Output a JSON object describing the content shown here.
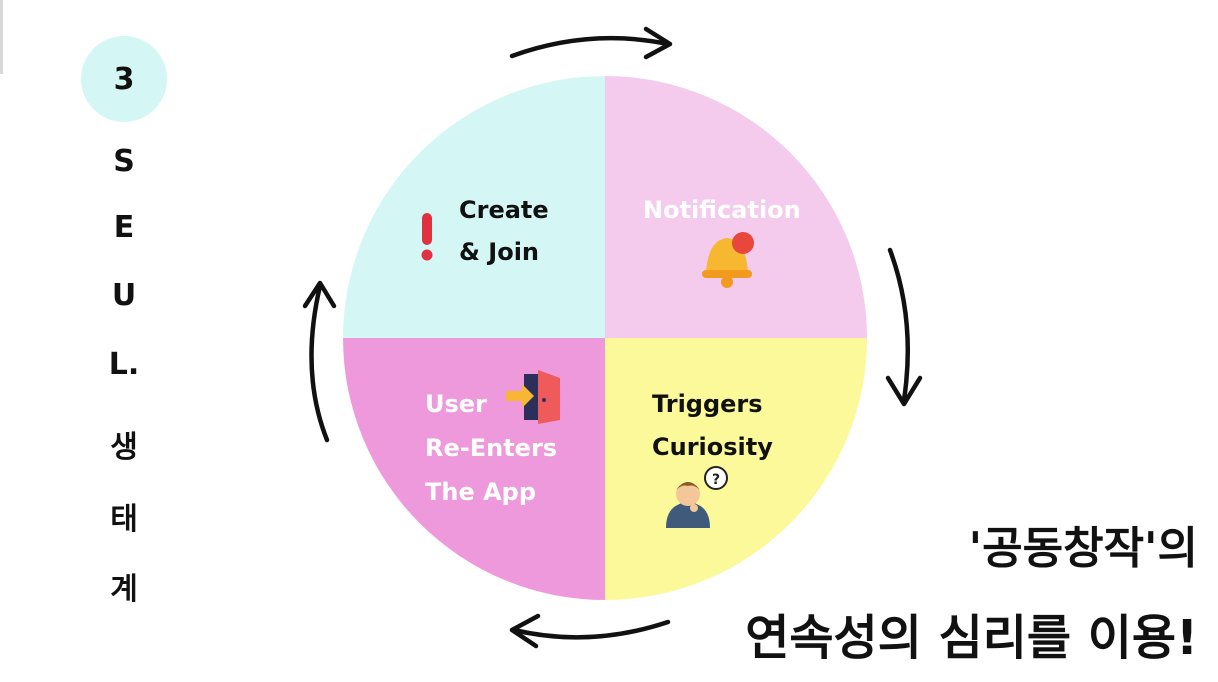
{
  "badge": {
    "number": "3"
  },
  "vertical_title": [
    "S",
    "E",
    "U",
    "L.",
    "생",
    "태",
    "계"
  ],
  "quadrants": {
    "top_left": {
      "lines": [
        "Create",
        "& Join"
      ],
      "fill": "#d4f7f5",
      "text_color": "#111111",
      "icon": "exclamation-icon"
    },
    "top_right": {
      "lines": [
        "Notification"
      ],
      "fill": "#f4cbed",
      "text_color": "#ffffff",
      "icon": "bell-icon"
    },
    "bottom_left": {
      "lines": [
        "User",
        "Re-Enters",
        "The App"
      ],
      "fill": "#ef99dd",
      "text_color": "#ffffff",
      "icon": "door-enter-icon"
    },
    "bottom_right": {
      "lines": [
        "Triggers",
        "Curiosity"
      ],
      "fill": "#fbf99a",
      "text_color": "#111111",
      "icon": "thinking-person-icon"
    }
  },
  "question_mark": "?",
  "caption": {
    "line1": "'공동창작'의",
    "line2": "연속성의 심리를 이용!"
  }
}
